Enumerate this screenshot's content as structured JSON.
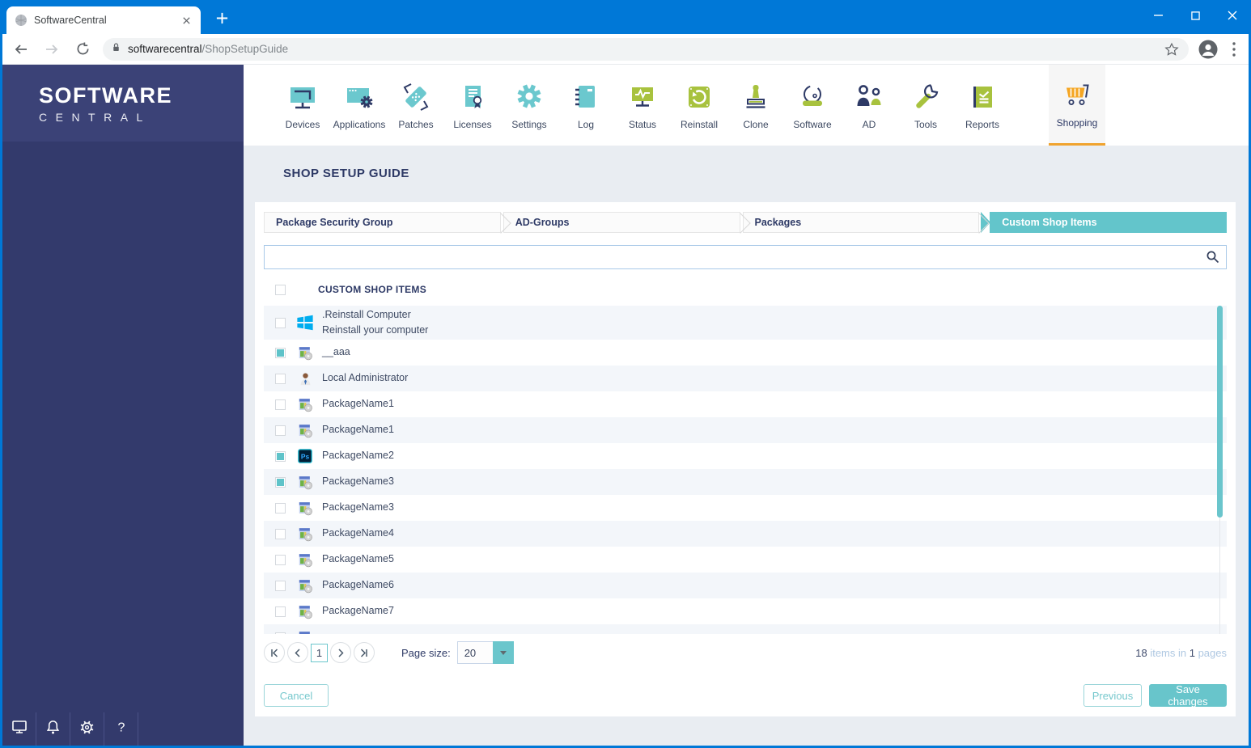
{
  "browser": {
    "tab_title": "SoftwareCentral",
    "url_host": "softwarecentral",
    "url_path": "/ShopSetupGuide"
  },
  "sidebar": {
    "logo_line1": "SOFTWARE",
    "logo_line2": "CENTRAL",
    "footer_icons": [
      "monitor",
      "bell",
      "gear",
      "help"
    ]
  },
  "nav": {
    "items": [
      {
        "label": "Devices",
        "icon": "devices",
        "active": false
      },
      {
        "label": "Applications",
        "icon": "applications",
        "active": false
      },
      {
        "label": "Patches",
        "icon": "patches",
        "active": false
      },
      {
        "label": "Licenses",
        "icon": "licenses",
        "active": false
      },
      {
        "label": "Settings",
        "icon": "settings",
        "active": false
      },
      {
        "label": "Log",
        "icon": "log",
        "active": false
      },
      {
        "label": "Status",
        "icon": "status",
        "active": false
      },
      {
        "label": "Reinstall",
        "icon": "reinstall",
        "active": false
      },
      {
        "label": "Clone",
        "icon": "clone",
        "active": false
      },
      {
        "label": "Software",
        "icon": "software",
        "active": false
      },
      {
        "label": "AD",
        "icon": "ad",
        "active": false
      },
      {
        "label": "Tools",
        "icon": "tools",
        "active": false
      },
      {
        "label": "Reports",
        "icon": "reports",
        "active": false
      },
      {
        "label": "Shopping",
        "icon": "shopping",
        "active": true
      }
    ]
  },
  "page": {
    "title": "SHOP SETUP GUIDE",
    "steps": [
      {
        "label": "Package Security Group",
        "active": false
      },
      {
        "label": "AD-Groups",
        "active": false
      },
      {
        "label": "Packages",
        "active": false
      },
      {
        "label": "Custom Shop Items",
        "active": true
      }
    ],
    "search": {
      "value": "",
      "placeholder": ""
    },
    "table": {
      "header": "CUSTOM SHOP ITEMS",
      "rows": [
        {
          "icon": "windows",
          "name": ".Reinstall Computer",
          "subtitle": "Reinstall your computer",
          "checked": false
        },
        {
          "icon": "package",
          "name": "__aaa",
          "subtitle": "",
          "checked": true
        },
        {
          "icon": "person",
          "name": "Local Administrator",
          "subtitle": "",
          "checked": false
        },
        {
          "icon": "package",
          "name": "PackageName1",
          "subtitle": "",
          "checked": false
        },
        {
          "icon": "package",
          "name": "PackageName1",
          "subtitle": "",
          "checked": false
        },
        {
          "icon": "ps",
          "name": "PackageName2",
          "subtitle": "",
          "checked": true
        },
        {
          "icon": "package",
          "name": "PackageName3",
          "subtitle": "",
          "checked": true
        },
        {
          "icon": "package",
          "name": "PackageName3",
          "subtitle": "",
          "checked": false
        },
        {
          "icon": "package",
          "name": "PackageName4",
          "subtitle": "",
          "checked": false
        },
        {
          "icon": "package",
          "name": "PackageName5",
          "subtitle": "",
          "checked": false
        },
        {
          "icon": "package",
          "name": "PackageName6",
          "subtitle": "",
          "checked": false
        },
        {
          "icon": "package",
          "name": "PackageName7",
          "subtitle": "",
          "checked": false
        },
        {
          "icon": "package",
          "name": "",
          "subtitle": "",
          "checked": false
        }
      ]
    },
    "pagination": {
      "current_page": "1",
      "page_size_label": "Page size:",
      "page_size_value": "20"
    },
    "summary": {
      "count_items": "18",
      "label_items": " items in ",
      "count_pages": "1",
      "label_pages": " pages"
    },
    "buttons": {
      "cancel": "Cancel",
      "previous": "Previous",
      "save": "Save changes"
    }
  },
  "colors": {
    "accent_teal": "#63C5CB",
    "accent_orange": "#F0A32F",
    "navy": "#2E3A66",
    "green": "#A8C23E",
    "chrome_blue": "#0078D7"
  }
}
